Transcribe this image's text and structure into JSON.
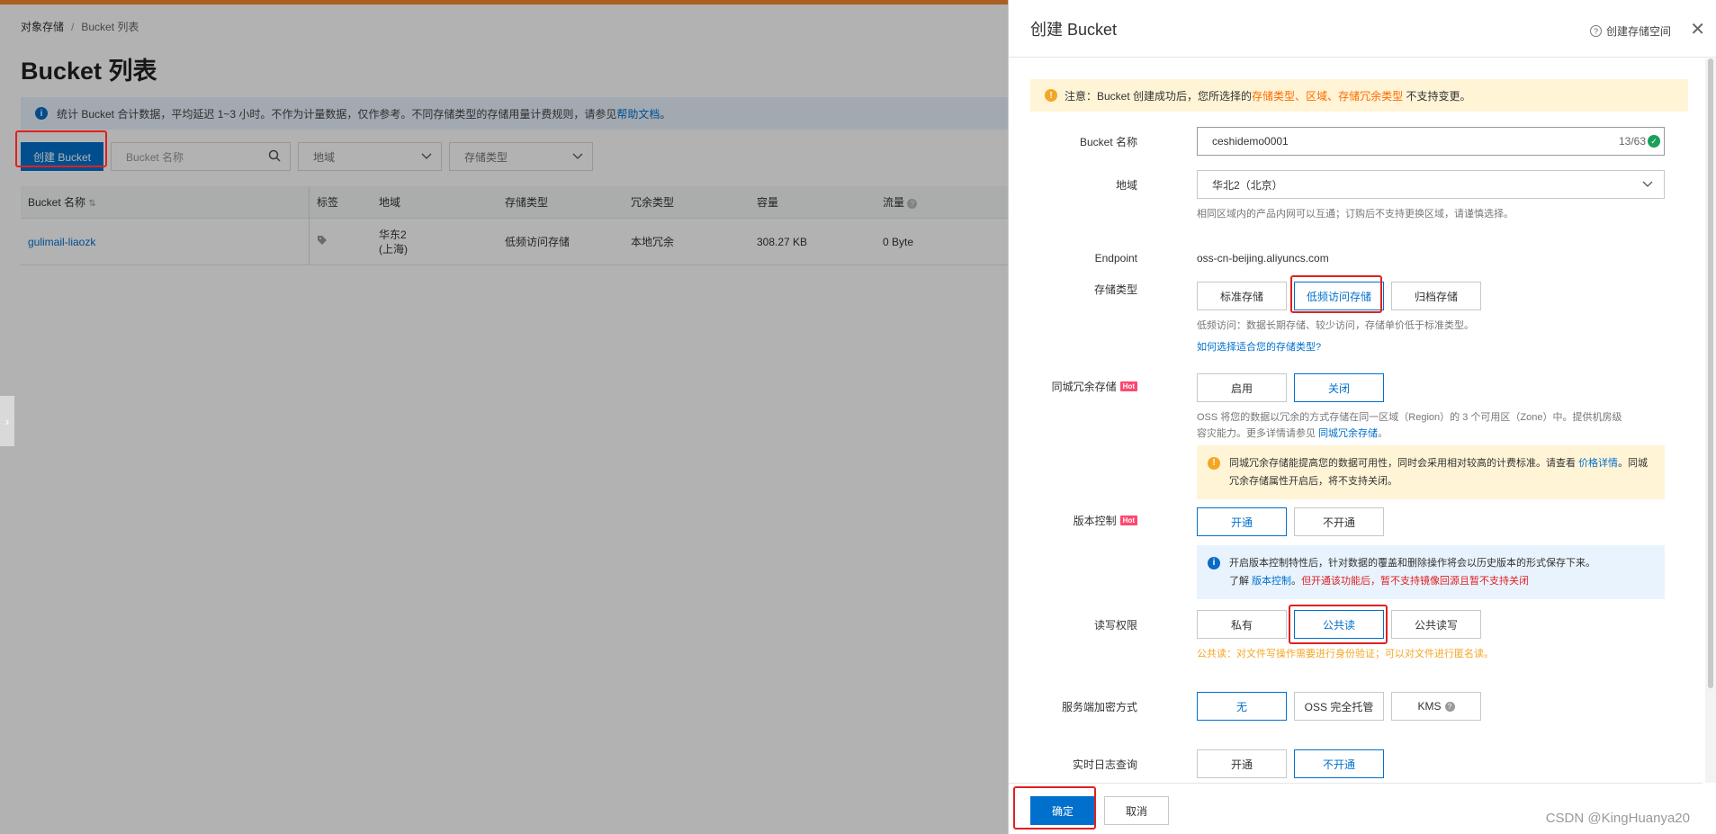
{
  "breadcrumb": {
    "root": "对象存储",
    "sep": "/",
    "current": "Bucket 列表"
  },
  "page_title": "Bucket 列表",
  "info_bar": {
    "text": "统计 Bucket 合计数据，平均延迟 1~3 小时。不作为计量数据，仅作参考。不同存储类型的存储用量计费规则，请参见",
    "link": "帮助文档",
    "end": "。"
  },
  "toolbar": {
    "create_label": "创建 Bucket",
    "search_placeholder": "Bucket 名称",
    "region_placeholder": "地域",
    "storage_placeholder": "存储类型"
  },
  "table": {
    "headers": [
      "Bucket 名称",
      "标签",
      "地域",
      "存储类型",
      "冗余类型",
      "容量",
      "流量"
    ],
    "sort_icon": "⇅",
    "rows": [
      {
        "name": "gulimail-liaozk",
        "region_line1": "华东2",
        "region_line2": "(上海)",
        "storage": "低频访问存储",
        "redundancy": "本地冗余",
        "capacity": "308.27 KB",
        "traffic": "0 Byte"
      }
    ]
  },
  "drawer": {
    "title": "创建 Bucket",
    "help_link": "创建存储空间",
    "notice": {
      "prefix": "注意：Bucket 创建成功后，您所选择的",
      "hl1": "存储类型",
      "sep1": "、",
      "hl2": "区域",
      "sep2": "、",
      "hl3": "存储冗余类型",
      "suffix": "不支持变更。"
    },
    "bucket_name": {
      "label": "Bucket 名称",
      "value": "ceshidemo0001",
      "counter": "13/63"
    },
    "region": {
      "label": "地域",
      "value": "华北2（北京）",
      "help": "相同区域内的产品内网可以互通；订购后不支持更换区域，请谨慎选择。"
    },
    "endpoint": {
      "label": "Endpoint",
      "value": "oss-cn-beijing.aliyuncs.com"
    },
    "storage_class": {
      "label": "存储类型",
      "options": [
        "标准存储",
        "低频访问存储",
        "归档存储"
      ],
      "selected": 1,
      "help": "低频访问：数据长期存储、较少访问，存储单价低于标准类型。",
      "link": "如何选择适合您的存储类型?"
    },
    "zrs": {
      "label": "同城冗余存储",
      "hot": "Hot",
      "options": [
        "启用",
        "关闭"
      ],
      "selected": 1,
      "help1": "OSS 将您的数据以冗余的方式存储在同一区域（Region）的 3 个可用区（Zone）中。提供机房级",
      "help2_prefix": "容灾能力。更多详情请参见",
      "help2_link": "同城冗余存储",
      "help2_end": "。",
      "tip_prefix": "同城冗余存储能提高您的数据可用性，同时会采用相对较高的计费标准。请查看",
      "tip_link": "价格详情",
      "tip_suffix": "。同城冗余存储属性开启后，将不支持关闭。"
    },
    "versioning": {
      "label": "版本控制",
      "hot": "Hot",
      "options": [
        "开通",
        "不开通"
      ],
      "selected": 0,
      "tip_line1": "开启版本控制特性后，针对数据的覆盖和删除操作将会以历史版本的形式保存下来。",
      "tip_line2_prefix": "了解",
      "tip_line2_link": "版本控制",
      "tip_line2_sep": "。",
      "tip_line2_red": "但开通该功能后，暂不支持镜像回源且暂不支持关闭"
    },
    "acl": {
      "label": "读写权限",
      "options": [
        "私有",
        "公共读",
        "公共读写"
      ],
      "selected": 1,
      "warning": "公共读：对文件写操作需要进行身份验证；可以对文件进行匿名读。"
    },
    "encryption": {
      "label": "服务端加密方式",
      "options": [
        "无",
        "OSS 完全托管",
        "KMS"
      ],
      "selected": 0
    },
    "realtime_log": {
      "label": "实时日志查询",
      "options": [
        "开通",
        "不开通"
      ],
      "selected": 1
    },
    "footer": {
      "ok": "确定",
      "cancel": "取消"
    },
    "watermark": "CSDN @KingHuanya20"
  },
  "colors": {
    "primary": "#0070cc",
    "orange": "#ff6a00",
    "hot": "#ff4770",
    "highlight": "#e02020"
  }
}
